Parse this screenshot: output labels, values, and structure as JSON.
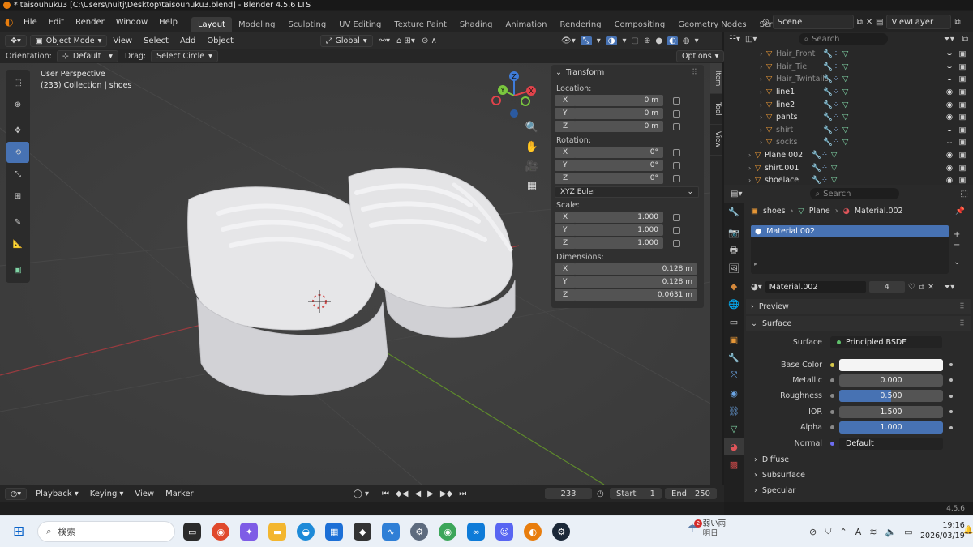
{
  "window": {
    "title": "* taisouhuku3 [C:\\Users\\nuitj\\Desktop\\taisouhuku3.blend] - Blender 4.5.6 LTS"
  },
  "menu": [
    "File",
    "Edit",
    "Render",
    "Window",
    "Help"
  ],
  "workspaces": [
    "Layout",
    "Modeling",
    "Sculpting",
    "UV Editing",
    "Texture Paint",
    "Shading",
    "Animation",
    "Rendering",
    "Compositing",
    "Geometry Nodes",
    "Scripting"
  ],
  "active_workspace": "Layout",
  "scene": {
    "label": "Scene",
    "view_layer": "ViewLayer"
  },
  "viewport_header": {
    "mode": "Object Mode",
    "menus": [
      "View",
      "Select",
      "Add",
      "Object"
    ],
    "orientation": "Global"
  },
  "tool_settings": {
    "orientation_label": "Orientation:",
    "orientation": "Default",
    "drag_label": "Drag:",
    "drag": "Select Circle",
    "options": "Options"
  },
  "viewport": {
    "perspective": "User Perspective",
    "collection": "(233) Collection | shoes"
  },
  "transform": {
    "title": "Transform",
    "location_label": "Location:",
    "location": {
      "x": "0 m",
      "y": "0 m",
      "z": "0 m"
    },
    "rotation_label": "Rotation:",
    "rotation": {
      "x": "0°",
      "y": "0°",
      "z": "0°"
    },
    "rotation_mode": "XYZ Euler",
    "scale_label": "Scale:",
    "scale": {
      "x": "1.000",
      "y": "1.000",
      "z": "1.000"
    },
    "dimensions_label": "Dimensions:",
    "dimensions": {
      "x": "0.128 m",
      "y": "0.128 m",
      "z": "0.0631 m"
    },
    "axes": {
      "x": "X",
      "y": "Y",
      "z": "Z"
    }
  },
  "n_tabs": [
    "Item",
    "Tool",
    "View"
  ],
  "outliner": {
    "search_placeholder": "Search",
    "rows": [
      {
        "name": "Hair_Front",
        "dim": true,
        "indent": 1
      },
      {
        "name": "Hair_Tie",
        "dim": true,
        "indent": 1
      },
      {
        "name": "Hair_Twintails",
        "dim": true,
        "indent": 1
      },
      {
        "name": "line1",
        "dim": false,
        "indent": 1
      },
      {
        "name": "line2",
        "dim": false,
        "indent": 1
      },
      {
        "name": "pants",
        "dim": false,
        "indent": 1
      },
      {
        "name": "shirt",
        "dim": true,
        "indent": 1
      },
      {
        "name": "socks",
        "dim": true,
        "indent": 1
      },
      {
        "name": "Plane.002",
        "dim": false,
        "indent": 0
      },
      {
        "name": "shirt.001",
        "dim": false,
        "indent": 0
      },
      {
        "name": "shoelace",
        "dim": false,
        "indent": 0
      }
    ]
  },
  "properties": {
    "search_placeholder": "Search",
    "breadcrumb": [
      "shoes",
      "Plane",
      "Material.002"
    ],
    "material_slot": "Material.002",
    "material_name": "Material.002",
    "user_count": "4",
    "preview": "Preview",
    "surface_section": "Surface",
    "surface_label": "Surface",
    "surface_shader": "Principled BSDF",
    "base_color_label": "Base Color",
    "metallic_label": "Metallic",
    "metallic": "0.000",
    "roughness_label": "Roughness",
    "roughness": "0.500",
    "roughness_fill": 0.5,
    "ior_label": "IOR",
    "ior": "1.500",
    "alpha_label": "Alpha",
    "alpha": "1.000",
    "alpha_fill": 1.0,
    "normal_label": "Normal",
    "normal": "Default",
    "diffuse": "Diffuse",
    "subsurface": "Subsurface",
    "specular": "Specular"
  },
  "timeline": {
    "menus": [
      "Playback",
      "Keying",
      "View",
      "Marker"
    ],
    "current_frame": "233",
    "start_label": "Start",
    "start": "1",
    "end_label": "End",
    "end": "250"
  },
  "status": {
    "version": "4.5.6"
  },
  "taskbar": {
    "search_placeholder": "検索",
    "weather_badge": "2",
    "weather": "弱い雨",
    "weather_sub": "明日",
    "time": "19:16",
    "date": "2026/03/19"
  },
  "colors": {
    "accent": "#4772b3",
    "object_orange": "#e59636",
    "axis_x": "#e2434b",
    "axis_y": "#7ac73e",
    "axis_z": "#3f7cd9"
  }
}
